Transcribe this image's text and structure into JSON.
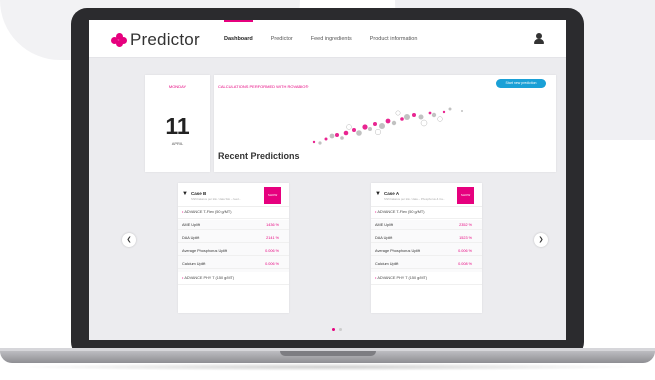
{
  "app": {
    "name": "Predictor",
    "nav": [
      "Dashboard",
      "Predictor",
      "Feed ingredients",
      "Product information"
    ]
  },
  "date_card": {
    "weekday": "MONDAY",
    "day": "11",
    "month": "APRIL"
  },
  "predictions": {
    "calc_label": "CALCULATIONS PERFORMED WITH ROVABIO®",
    "start_button": "Start new prediction",
    "title": "Recent Predictions"
  },
  "cases": [
    {
      "name": "Case B",
      "subtitle": "Shift balance per kilo / data Silo – feed...",
      "tag": "SHOW",
      "product1": "ADVANCE T-Flex (50 g/MT)",
      "rows": [
        {
          "label": "AME Uplift",
          "value": "1436 %"
        },
        {
          "label": "DAA Uplift",
          "value": "2141 %"
        },
        {
          "label": "Average Phosphorus Uplift",
          "value": "0.006 %"
        },
        {
          "label": "Calcium Uplift",
          "value": "0.006 %"
        }
      ],
      "product2": "ADVANCE PHY T (150 g/MT)"
    },
    {
      "name": "Case A",
      "subtitle": "Shift balance per kilo / data – Phosphorus & Ca...",
      "tag": "SHOW",
      "product1": "ADVANCE T-Flex (50 g/MT)",
      "rows": [
        {
          "label": "AME Uplift",
          "value": "2352 %"
        },
        {
          "label": "DAA Uplift",
          "value": "1523 %"
        },
        {
          "label": "Average Phosphorus Uplift",
          "value": "0.006 %"
        },
        {
          "label": "Calcium Uplift",
          "value": "0.008 %"
        }
      ],
      "product2": "ADVANCE PHY T (150 g/MT)"
    }
  ],
  "colors": {
    "brand": "#e6007e",
    "button": "#1aa0d6"
  },
  "icons": [
    "user-icon",
    "chevron-left-icon",
    "chevron-right-icon",
    "chevron-down-icon",
    "logo-icon"
  ]
}
